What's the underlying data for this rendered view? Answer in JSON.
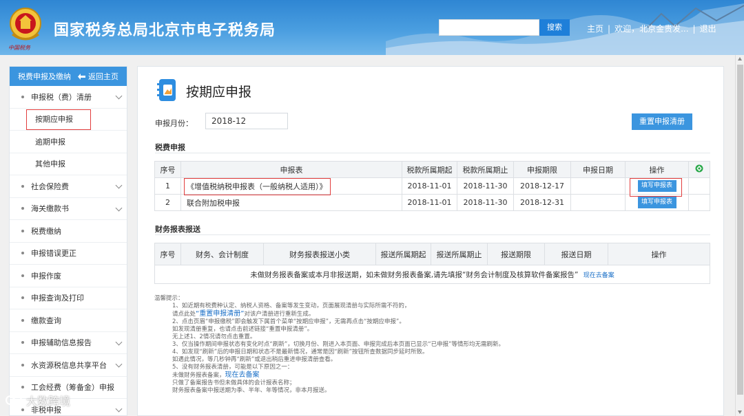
{
  "header": {
    "title": "国家税务总局北京市电子税务局",
    "emblem_caption": "中国税务",
    "search_placeholder": "",
    "search_button": "搜索",
    "links": {
      "home": "主页",
      "welcome": "欢迎，北京金贵发...",
      "logout": "退出"
    },
    "emblem_icon": "tax-emblem-icon"
  },
  "sidebar": {
    "header_label": "税费申报及缴纳",
    "back_label": "返回主页",
    "items": [
      {
        "label": "申报税（费）清册",
        "type": "group",
        "expanded": true
      },
      {
        "label": "按期应申报",
        "type": "sub",
        "active": true
      },
      {
        "label": "逾期申报",
        "type": "sub"
      },
      {
        "label": "其他申报",
        "type": "sub"
      },
      {
        "label": "社会保险费",
        "type": "group"
      },
      {
        "label": "海关缴款书",
        "type": "group"
      },
      {
        "label": "税费缴纳",
        "type": "item"
      },
      {
        "label": "申报错误更正",
        "type": "item"
      },
      {
        "label": "申报作废",
        "type": "item"
      },
      {
        "label": "申报查询及打印",
        "type": "item"
      },
      {
        "label": "缴款查询",
        "type": "item"
      },
      {
        "label": "申报辅助信息报告",
        "type": "group"
      },
      {
        "label": "水资源税信息共享平台",
        "type": "group"
      },
      {
        "label": "工会经费（筹备金）申报",
        "type": "item"
      },
      {
        "label": "非税申报",
        "type": "group"
      }
    ]
  },
  "main": {
    "title": "按期应申报",
    "month_label": "申报月份：",
    "month_value": "2018-12",
    "reset_button": "重置申报清册",
    "tax_section": "税费申报",
    "tax_table": {
      "headers": [
        "序号",
        "申报表",
        "税款所属期起",
        "税款所属期止",
        "申报期限",
        "申报日期",
        "操作"
      ],
      "rows": [
        {
          "no": "1",
          "form": "《增值税纳税申报表（一般纳税人适用）》",
          "start": "2018-11-01",
          "end": "2018-11-30",
          "deadline": "2018-12-17",
          "date": "",
          "action": "填写申报表"
        },
        {
          "no": "2",
          "form": "联合附加税申报",
          "start": "2018-11-01",
          "end": "2018-11-30",
          "deadline": "2018-12-31",
          "date": "",
          "action": "填写申报表"
        }
      ]
    },
    "fin_section": "财务报表报送",
    "fin_table": {
      "headers": [
        "序号",
        "财务、会计制度",
        "财务报表报送小类",
        "报送所属期起",
        "报送所属期止",
        "报送期限",
        "报送日期",
        "操作"
      ],
      "empty_text": "未做财务报表备案或本月非报送期，如未做财务报表备案,请先填报“财务会计制度及核算软件备案报告”",
      "empty_link": "现在去备案"
    },
    "tips": {
      "title": "温馨提示：",
      "l1": "1、如近期有税费种认定、纳税人资格、备案等发生变动，页面展现清册与实际所需不符的，",
      "l1b_pre": "请点此处",
      "l1b_link": "“重置申报清册”",
      "l1b_post": "对该户清册进行重新生成。",
      "l2": "2、点击页眉“申报缴税”即会触发下属首个菜单“按期应申报”，无需再点击“按期应申报”。",
      "l2b": "如发现清册重复，也请点击前述链接“重置申报清册”。",
      "l3": "无上述1、2情况请勿点击重置。",
      "l4": "3、仅当操作期间申报状态有变化时点“刷新”，切换月份、刚进入本页面、申报完成后本页面已显示“已申报”等情形均无需刷新。",
      "l5": "4、如发现“刷新”后的申报日期和状态不是最新情况，通常是因“刷新”按钮所查数据同步延时所致。",
      "l5b": "如遇此情况，等几秒钟再“刷新”或退出稍后重进申报清册查看。",
      "l6": "5、没有财务报表清册，可能是以下原因之一：",
      "l6a_pre": "未做财务报表备案，",
      "l6a_link": "现在去备案",
      "l6b": "只做了备案报告书但未做具体的会计报表名称；",
      "l6c": "财务报表备案中报送期为季、半年、年等情况，非本月报送。"
    }
  },
  "watermark": "大数跨境",
  "colors": {
    "accent": "#3b95df",
    "highlight": "#e23c3c",
    "header": "#2f86d3"
  }
}
